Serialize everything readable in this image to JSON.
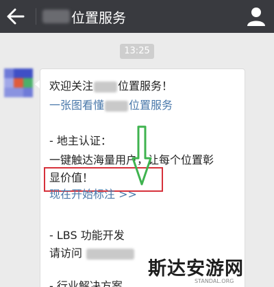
{
  "header": {
    "back_icon": "arrow-left-icon",
    "title": "位置服务",
    "profile_icon": "person-icon",
    "background": "#393a3f"
  },
  "chat": {
    "timestamp": "13:25",
    "message": {
      "greeting_prefix": "欢迎关注",
      "greeting_suffix": "位置服务！",
      "intro_prefix": "一张图看懂",
      "intro_suffix": "位置服务",
      "landlord_heading": "- 地主认证：",
      "landlord_line1": "一键触达海量用户，让每个位置彰",
      "landlord_line2": "显价值！",
      "cta_link": "现在开始标注 >>",
      "lbs_heading": "- LBS 功能开发",
      "lbs_visit": "请访问",
      "industry_heading": "- 行业解决方案"
    }
  },
  "annotations": {
    "highlight_color": "#d6303a",
    "arrow_color": "#3fb34f"
  },
  "watermark": {
    "main": "斯达安游网",
    "sub": "STANDAL.ORG"
  }
}
